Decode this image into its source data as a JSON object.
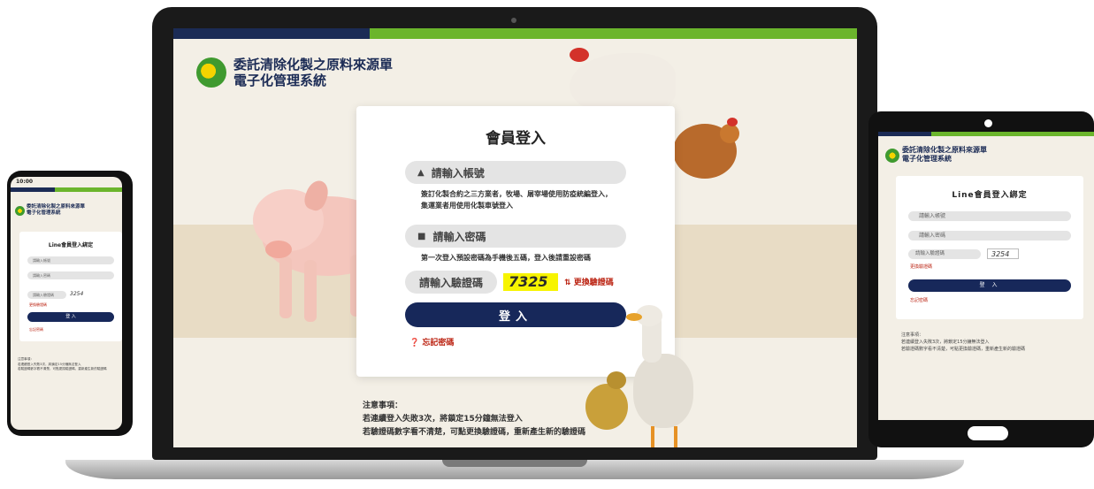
{
  "site": {
    "title_line1": "委託清除化製之原料來源單",
    "title_line2": "電子化管理系統"
  },
  "colors": {
    "navy": "#1b2b55",
    "green": "#6bb52c",
    "button": "#17285a",
    "accent_red": "#b21",
    "captcha_bg": "#f7f400"
  },
  "login": {
    "heading": "會員登入",
    "account_placeholder": "請輸入帳號",
    "account_hint_line1": "簽訂化製合約之三方業者，牧場、屠宰場使用防疫統編登入，",
    "account_hint_line2": "集運業者用使用化製車號登入",
    "password_placeholder": "請輸入密碼",
    "password_hint": "第一次登入預設密碼為手機後五碼，登入後請重設密碼",
    "captcha_placeholder": "請輸入驗證碼",
    "captcha_value": "7325",
    "refresh_label": "更換驗證碼",
    "submit_label": "登入",
    "forgot_label": "忘記密碼",
    "user_icon": "user-icon",
    "lock_icon": "lock-icon"
  },
  "notice": {
    "heading": "注意事項：",
    "line1": "若連續登入失敗3次，將鎖定15分鐘無法登入",
    "line2": "若驗證碼數字看不清楚，可點更換驗證碼，重新產生新的驗證碼"
  },
  "phone": {
    "status_time": "10:00",
    "card_title": "Line會員登入綁定",
    "account_placeholder": "請輸入帳號",
    "password_placeholder": "請輸入密碼",
    "captcha_placeholder": "請輸入驗證碼",
    "captcha_value": "3254",
    "refresh_label": "更換驗證碼",
    "submit_label": "登 入",
    "forgot_label": "忘記密碼"
  },
  "tablet": {
    "card_title": "Line會員登入綁定",
    "account_placeholder": "請輸入帳號",
    "password_placeholder": "請輸入密碼",
    "captcha_placeholder": "請輸入驗證碼",
    "captcha_value": "3254",
    "refresh_label": "更換驗證碼",
    "submit_label": "登 入",
    "forgot_label": "忘記密碼"
  }
}
